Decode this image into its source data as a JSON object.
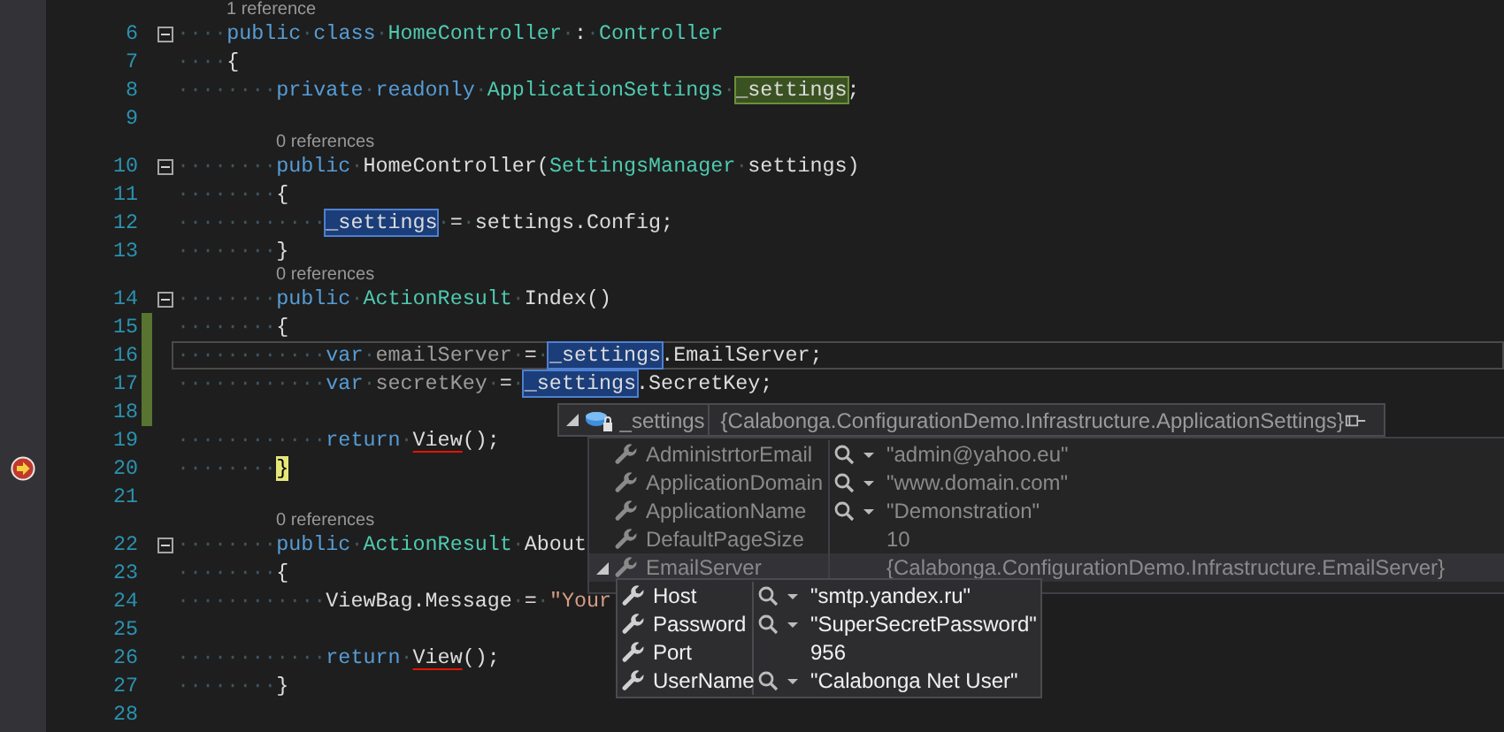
{
  "lines": [
    {
      "kind": "lens",
      "text": "1 reference"
    },
    {
      "kind": "code",
      "number": "6",
      "changed": false,
      "foldable": true,
      "caret": false,
      "executing": false,
      "tokens": [
        {
          "kind": "keyword",
          "text": "····public"
        },
        {
          "kind": "keyword",
          "text": "·class"
        },
        {
          "kind": "type",
          "text": "·HomeController"
        },
        {
          "kind": "plain",
          "text": "·:"
        },
        {
          "kind": "type",
          "text": "·Controller"
        }
      ]
    },
    {
      "kind": "code",
      "number": "7",
      "changed": false,
      "foldable": false,
      "caret": false,
      "executing": false,
      "tokens": [
        {
          "kind": "plain",
          "text": "····{"
        }
      ]
    },
    {
      "kind": "code",
      "number": "8",
      "changed": false,
      "foldable": false,
      "caret": false,
      "executing": false,
      "tokens": [
        {
          "kind": "keyword",
          "text": "········private·readonly"
        },
        {
          "kind": "type",
          "text": "·ApplicationSettings·"
        },
        {
          "kind": "definition",
          "text": "_settings"
        },
        {
          "kind": "plain",
          "text": ";"
        }
      ]
    },
    {
      "kind": "code",
      "number": "9",
      "changed": false,
      "foldable": false,
      "caret": false,
      "executing": false
    },
    {
      "kind": "lens",
      "text": "0 references"
    },
    {
      "kind": "code",
      "number": "10",
      "changed": false,
      "foldable": true,
      "caret": false,
      "executing": false,
      "tokens": [
        {
          "kind": "keyword",
          "text": "········public"
        },
        {
          "kind": "plain",
          "text": "·HomeController("
        },
        {
          "kind": "type",
          "text": "SettingsManager"
        },
        {
          "kind": "plain",
          "text": "·settings)"
        }
      ]
    },
    {
      "kind": "code",
      "number": "11",
      "changed": false,
      "foldable": false,
      "caret": false,
      "executing": false,
      "tokens": [
        {
          "kind": "plain",
          "text": "········{"
        }
      ]
    },
    {
      "kind": "code",
      "number": "12",
      "changed": false,
      "foldable": false,
      "caret": false,
      "executing": false,
      "tokens": [
        {
          "kind": "plain",
          "text": "············"
        },
        {
          "kind": "reference",
          "text": "_settings"
        },
        {
          "kind": "plain",
          "text": "·=·settings.Config;"
        }
      ]
    },
    {
      "kind": "code",
      "number": "13",
      "changed": false,
      "foldable": false,
      "caret": false,
      "executing": false,
      "tokens": [
        {
          "kind": "plain",
          "text": "········}"
        }
      ]
    },
    {
      "kind": "lens",
      "text": "0 references"
    },
    {
      "kind": "code",
      "number": "14",
      "changed": false,
      "foldable": true,
      "caret": false,
      "executing": false,
      "tokens": [
        {
          "kind": "keyword",
          "text": "········public"
        },
        {
          "kind": "type",
          "text": "·ActionResult"
        },
        {
          "kind": "plain",
          "text": "·Index()"
        }
      ]
    },
    {
      "kind": "code",
      "number": "15",
      "changed": true,
      "foldable": false,
      "caret": false,
      "executing": false,
      "tokens": [
        {
          "kind": "plain",
          "text": "········{"
        }
      ]
    },
    {
      "kind": "code",
      "number": "16",
      "changed": true,
      "foldable": false,
      "caret": true,
      "executing": false,
      "tokens": [
        {
          "kind": "keyword",
          "text": "············var"
        },
        {
          "kind": "faded",
          "text": "·emailServer"
        },
        {
          "kind": "plain",
          "text": "·=·"
        },
        {
          "kind": "reference",
          "text": "_settings"
        },
        {
          "kind": "plain",
          "text": ".EmailServer;"
        }
      ]
    },
    {
      "kind": "code",
      "number": "17",
      "changed": true,
      "foldable": false,
      "caret": false,
      "executing": false,
      "tokens": [
        {
          "kind": "keyword",
          "text": "············var"
        },
        {
          "kind": "faded",
          "text": "·secretKey"
        },
        {
          "kind": "plain",
          "text": "·=·"
        },
        {
          "kind": "reference",
          "text": "_settings"
        },
        {
          "kind": "plain",
          "text": ".SecretKey;"
        }
      ]
    },
    {
      "kind": "code",
      "number": "18",
      "changed": true,
      "foldable": false,
      "caret": false,
      "executing": false
    },
    {
      "kind": "code",
      "number": "19",
      "changed": false,
      "foldable": false,
      "caret": false,
      "executing": false,
      "tokens": [
        {
          "kind": "keyword",
          "text": "············return·"
        },
        {
          "kind": "error",
          "text": "View"
        },
        {
          "kind": "plain",
          "text": "();"
        }
      ]
    },
    {
      "kind": "code",
      "number": "20",
      "changed": false,
      "foldable": false,
      "caret": false,
      "executing": true,
      "tokens": [
        {
          "kind": "plain",
          "text": "········"
        },
        {
          "kind": "current",
          "text": "}"
        }
      ]
    },
    {
      "kind": "code",
      "number": "21",
      "changed": false,
      "foldable": false,
      "caret": false,
      "executing": false
    },
    {
      "kind": "lens",
      "text": "0 references"
    },
    {
      "kind": "code",
      "number": "22",
      "changed": false,
      "foldable": true,
      "caret": false,
      "executing": false,
      "tokens": [
        {
          "kind": "keyword",
          "text": "········public"
        },
        {
          "kind": "type",
          "text": "·ActionResult"
        },
        {
          "kind": "plain",
          "text": "·About"
        }
      ]
    },
    {
      "kind": "code",
      "number": "23",
      "changed": false,
      "foldable": false,
      "caret": false,
      "executing": false,
      "tokens": [
        {
          "kind": "plain",
          "text": "········{"
        }
      ]
    },
    {
      "kind": "code",
      "number": "24",
      "changed": false,
      "foldable": false,
      "caret": false,
      "executing": false,
      "tokens": [
        {
          "kind": "plain",
          "text": "············ViewBag.Message·=·"
        },
        {
          "kind": "string",
          "text": "\"Your"
        }
      ]
    },
    {
      "kind": "code",
      "number": "25",
      "changed": false,
      "foldable": false,
      "caret": false,
      "executing": false
    },
    {
      "kind": "code",
      "number": "26",
      "changed": false,
      "foldable": false,
      "caret": false,
      "executing": false,
      "tokens": [
        {
          "kind": "keyword",
          "text": "············return·"
        },
        {
          "kind": "error",
          "text": "View"
        },
        {
          "kind": "plain",
          "text": "();"
        }
      ]
    },
    {
      "kind": "code",
      "number": "27",
      "changed": false,
      "foldable": false,
      "caret": false,
      "executing": false,
      "tokens": [
        {
          "kind": "plain",
          "text": "········}"
        }
      ]
    },
    {
      "kind": "code",
      "number": "28",
      "changed": false,
      "foldable": false,
      "caret": false,
      "executing": false
    }
  ],
  "datatip": {
    "name": "_settings",
    "value": "{Calabonga.ConfigurationDemo.Infrastructure.ApplicationSettings}",
    "rows": [
      {
        "name": "AdministrtorEmail",
        "inspect": true,
        "value": "\"admin@yahoo.eu\"",
        "expandable": false,
        "selected": false
      },
      {
        "name": "ApplicationDomain",
        "inspect": true,
        "value": "\"www.domain.com\"",
        "expandable": false,
        "selected": false
      },
      {
        "name": "ApplicationName",
        "inspect": true,
        "value": "\"Demonstration\"",
        "expandable": false,
        "selected": false
      },
      {
        "name": "DefaultPageSize",
        "inspect": false,
        "value": "10",
        "expandable": false,
        "selected": false
      },
      {
        "name": "EmailServer",
        "inspect": false,
        "value": "{Calabonga.ConfigurationDemo.Infrastructure.EmailServer}",
        "expandable": true,
        "selected": true
      }
    ],
    "child_rows": [
      {
        "name": "Host",
        "inspect": true,
        "value": "\"smtp.yandex.ru\""
      },
      {
        "name": "Password",
        "inspect": true,
        "value": "\"SuperSecretPassword\""
      },
      {
        "name": "Port",
        "inspect": false,
        "value": "956"
      },
      {
        "name": "UserName",
        "inspect": true,
        "value": "\"Calabonga Net User\""
      }
    ]
  }
}
